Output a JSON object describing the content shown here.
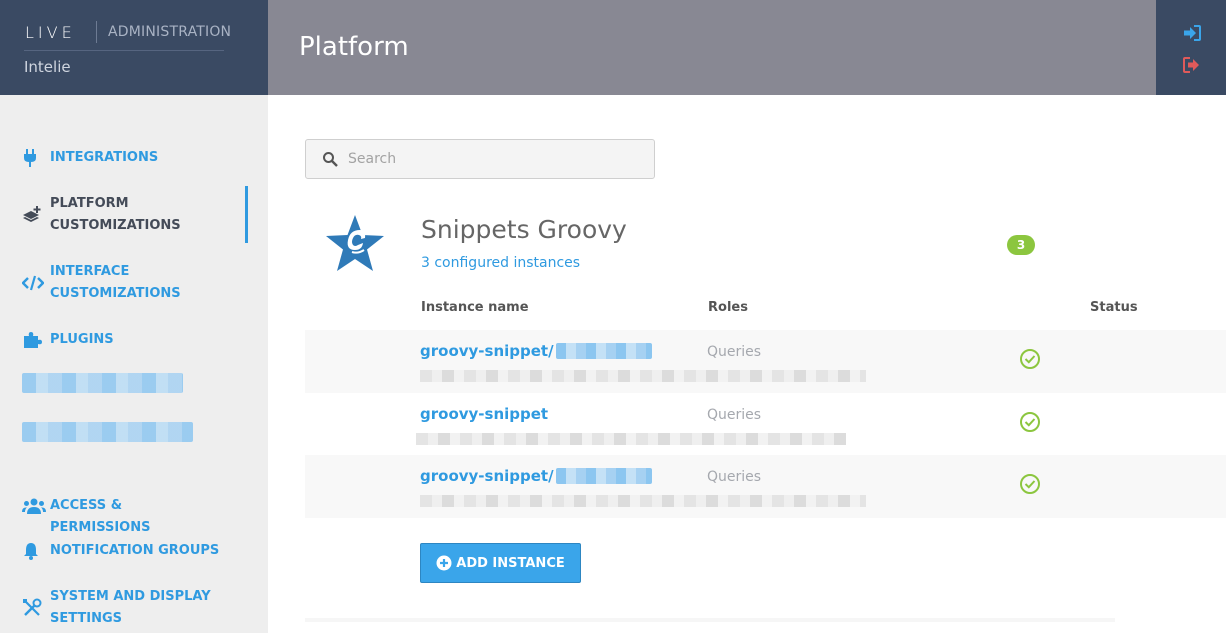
{
  "brand": {
    "logo": "LIVE",
    "section": "ADMINISTRATION",
    "organization": "Intelie"
  },
  "header": {
    "title": "Platform",
    "tools": [
      {
        "icon": "sign-in-icon",
        "color": "#3aa5ea"
      },
      {
        "icon": "sign-out-icon",
        "color": "#e05a5a"
      }
    ]
  },
  "sidebar": {
    "items": [
      {
        "label": "INTEGRATIONS",
        "icon": "plug-icon",
        "active": false
      },
      {
        "label": "PLATFORM CUSTOMIZATIONS",
        "icon": "layers-add-icon",
        "active": true
      },
      {
        "label": "INTERFACE CUSTOMIZATIONS",
        "icon": "code-icon",
        "active": false
      },
      {
        "label": "PLUGINS",
        "icon": "puzzle-icon",
        "active": false
      },
      {
        "label": "ACCESS & PERMISSIONS",
        "icon": "users-icon",
        "active": false
      },
      {
        "label": "NOTIFICATION GROUPS",
        "icon": "bell-icon",
        "active": false
      },
      {
        "label": "SYSTEM AND DISPLAY SETTINGS",
        "icon": "tools-icon",
        "active": false
      }
    ]
  },
  "search": {
    "placeholder": "Search"
  },
  "plugin": {
    "title": "Snippets Groovy",
    "subtitle": "3 configured instances",
    "count": "3"
  },
  "table": {
    "columns": [
      "Instance name",
      "Roles",
      "Status"
    ],
    "rows": [
      {
        "name": "groovy-snippet/",
        "role": "Queries",
        "status": "ok"
      },
      {
        "name": "groovy-snippet",
        "role": "Queries",
        "status": "ok"
      },
      {
        "name": "groovy-snippet/",
        "role": "Queries",
        "status": "ok"
      }
    ]
  },
  "actions": {
    "add_instance": "ADD INSTANCE"
  },
  "colors": {
    "accent": "#2f9ae0",
    "sidebar_bg": "#eeeeee",
    "header_bg": "#888893",
    "brand_bg": "#3a4a63",
    "badge": "#8cc63f",
    "status_ok": "#8cc63f"
  }
}
